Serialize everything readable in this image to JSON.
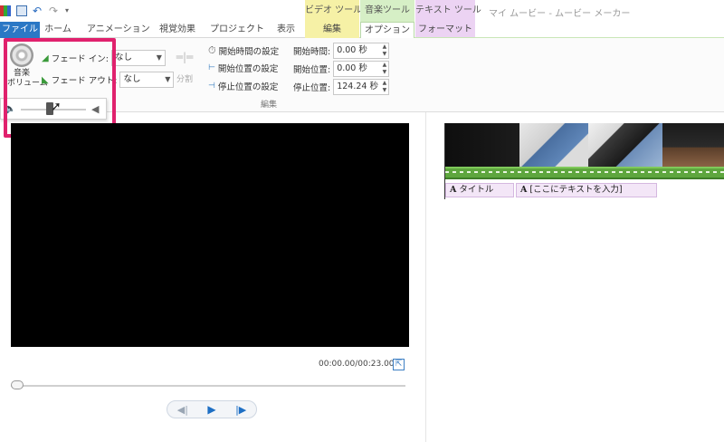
{
  "app_title": "マイ ムービー - ムービー メーカー",
  "context_tabs": {
    "video_tools": "ビデオ ツール",
    "music_tools": "音楽ツール",
    "text_tools": "テキスト ツール"
  },
  "tabs": {
    "file": "ファイル",
    "home": "ホーム",
    "animation": "アニメーション",
    "visual_effects": "視覚効果",
    "project": "プロジェクト",
    "view": "表示",
    "edit": "編集",
    "options": "オプション",
    "format": "フォーマット"
  },
  "ribbon": {
    "music_volume": {
      "line1": "音楽",
      "line2": "ボリューム"
    },
    "fade_in": {
      "label": "フェード イン:",
      "value": "なし"
    },
    "fade_out": {
      "label": "フェード アウト:",
      "value": "なし"
    },
    "split": "分割",
    "set_start_time": "開始時間の設定",
    "set_start_point": "開始位置の設定",
    "set_end_point": "停止位置の設定",
    "start_time": {
      "label": "開始時間:",
      "value": "0.00 秒"
    },
    "start_point": {
      "label": "開始位置:",
      "value": "0.00 秒"
    },
    "end_point": {
      "label": "停止位置:",
      "value": "124.24 秒"
    },
    "group_edit": "編集"
  },
  "volume_popup": {
    "level": 0.45
  },
  "preview": {
    "timecode": "00:00.00/00:23.00"
  },
  "storyboard": {
    "caption_title": "タイトル",
    "caption_text": "[ここにテキストを入力]",
    "caption_glyph": "A"
  },
  "colors": {
    "highlight": "#e0216d",
    "file_tab": "#2b78c5",
    "music_bar": "#5ea63e"
  }
}
